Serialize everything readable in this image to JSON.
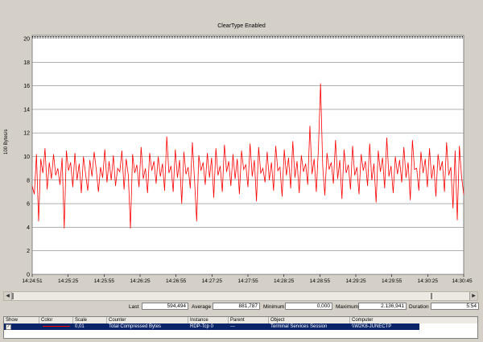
{
  "chart": {
    "title": "ClearType Enabled",
    "ylabel": "100 Bytes/s"
  },
  "stats": {
    "last_label": "Last",
    "last_value": "594,494",
    "average_label": "Average",
    "average_value": "881,787",
    "minimum_label": "Minimum",
    "minimum_value": "0,000",
    "maximum_label": "Maximum",
    "maximum_value": "2.136,941",
    "duration_label": "Duration",
    "duration_value": "5:54"
  },
  "legend": {
    "headers": [
      "Show",
      "Color",
      "Scale",
      "Counter",
      "Instance",
      "Parent",
      "Object",
      "Computer"
    ],
    "row": {
      "show": "✓",
      "scale": "0,01",
      "counter": "Total Compressed Bytes",
      "instance": "RDP-Tcp 0",
      "parent": "---",
      "object": "Terminal Services Session",
      "computer": "\\\\W2K8-JUNECTP"
    }
  },
  "colors": {
    "series": "#ff0000",
    "background": "#d4d0c8",
    "selection": "#0a246a"
  },
  "chart_data": {
    "type": "line",
    "title": "ClearType Enabled",
    "xlabel": "",
    "ylabel": "100 Bytes/s",
    "ylim": [
      0,
      20
    ],
    "yticks": [
      0,
      2,
      4,
      6,
      8,
      10,
      12,
      14,
      16,
      18,
      20
    ],
    "xticks": [
      "14:24:51",
      "14:25:25",
      "14:25:55",
      "14:26:25",
      "14:26:55",
      "14:27:25",
      "14:27:55",
      "14:28:25",
      "14:28:55",
      "14:29:25",
      "14:29:55",
      "14:30:25",
      "14:30:45"
    ],
    "grid": true,
    "series": [
      {
        "values": [
          7.5,
          6.8,
          10.2,
          4.5,
          9.8,
          8.6,
          10.7,
          7.2,
          9.5,
          8.1,
          10.2,
          8.4,
          9.0,
          7.6,
          9.9,
          3.9,
          10.5,
          8.8,
          9.5,
          7.4,
          10.3,
          8.0,
          9.4,
          6.9,
          10.0,
          8.5,
          7.1,
          9.7,
          8.3,
          10.4,
          8.9,
          7.0,
          9.1,
          8.2,
          10.6,
          7.8,
          9.6,
          8.0,
          10.1,
          7.5,
          9.0,
          8.7,
          10.5,
          7.2,
          9.8,
          8.4,
          3.9,
          10.2,
          8.6,
          9.3,
          7.4,
          10.8,
          8.1,
          9.0,
          6.9,
          10.3,
          8.8,
          9.6,
          7.7,
          10.0,
          8.3,
          9.4,
          7.1,
          11.7,
          8.6,
          9.2,
          7.0,
          10.6,
          8.2,
          9.7,
          6.0,
          10.4,
          8.5,
          9.1,
          7.3,
          11.2,
          8.0,
          4.5,
          10.1,
          8.8,
          9.5,
          7.6,
          10.3,
          8.2,
          9.9,
          6.5,
          10.7,
          8.4,
          9.2,
          7.0,
          11.0,
          8.7,
          9.6,
          7.5,
          10.2,
          8.1,
          9.8,
          6.8,
          10.5,
          8.9,
          9.3,
          7.4,
          11.1,
          8.3,
          9.7,
          6.2,
          10.8,
          8.6,
          9.0,
          7.8,
          10.4,
          8.0,
          9.5,
          7.1,
          10.9,
          8.8,
          9.1,
          6.6,
          10.6,
          8.4,
          9.9,
          7.3,
          11.3,
          8.2,
          9.6,
          6.9,
          10.1,
          8.7,
          9.4,
          7.6,
          12.6,
          8.5,
          9.8,
          7.0,
          10.7,
          16.2,
          9.2,
          6.7,
          10.3,
          8.9,
          9.5,
          7.7,
          11.4,
          8.1,
          9.7,
          6.4,
          10.6,
          8.6,
          9.3,
          7.2,
          10.9,
          8.4,
          9.1,
          6.8,
          10.2,
          8.8,
          9.6,
          7.5,
          11.1,
          8.0,
          9.4,
          6.1,
          10.5,
          8.7,
          9.9,
          7.3,
          11.6,
          8.3,
          9.2,
          6.9,
          10.0,
          8.5,
          9.7,
          7.8,
          10.8,
          8.2,
          9.5,
          6.3,
          11.4,
          8.9,
          9.0,
          7.1,
          10.4,
          8.6,
          9.8,
          7.4,
          10.7,
          8.1,
          9.3,
          6.6,
          10.2,
          8.8,
          9.6,
          7.0,
          11.2,
          8.4,
          9.1,
          5.6,
          10.5,
          4.6,
          10.9,
          8.3,
          6.8
        ]
      }
    ]
  }
}
